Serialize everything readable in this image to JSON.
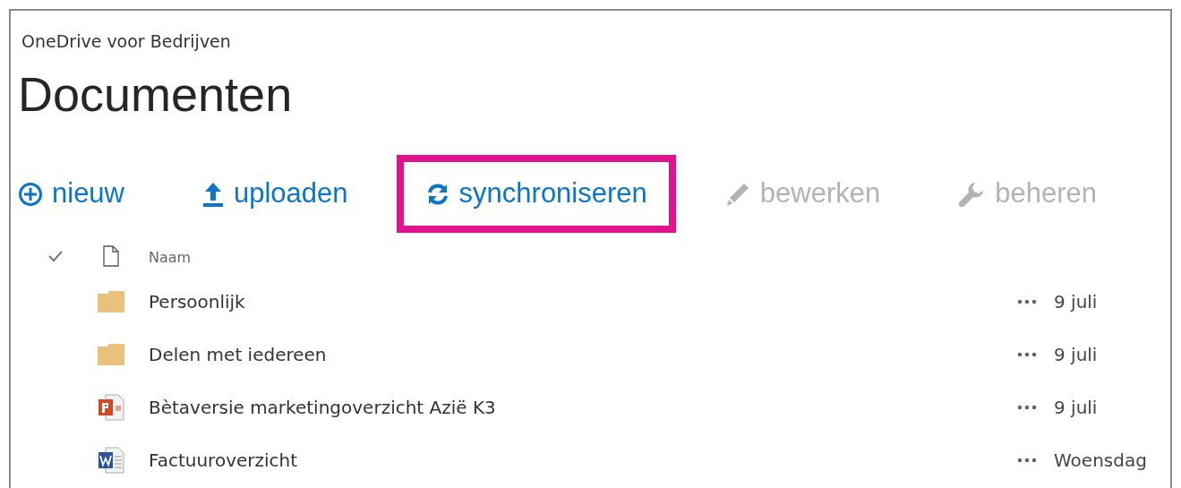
{
  "breadcrumb": "OneDrive voor Bedrijven",
  "title": "Documenten",
  "toolbar": [
    {
      "kind": "add",
      "label": "nieuw",
      "disabled": false,
      "highlighted": false
    },
    {
      "kind": "upload",
      "label": "uploaden",
      "disabled": false,
      "highlighted": false
    },
    {
      "kind": "sync",
      "label": "synchroniseren",
      "disabled": false,
      "highlighted": true
    },
    {
      "kind": "edit",
      "label": "bewerken",
      "disabled": true,
      "highlighted": false
    },
    {
      "kind": "manage",
      "label": "beheren",
      "disabled": true,
      "highlighted": false
    }
  ],
  "table": {
    "columns": [
      {
        "label": "Naam"
      }
    ],
    "rows": [
      {
        "kind": "folder",
        "name": "Persoonlijk",
        "modified": "9 juli"
      },
      {
        "kind": "folder",
        "name": "Delen met iedereen",
        "modified": "9 juli"
      },
      {
        "kind": "powerpoint",
        "name": "Bètaversie marketingoverzicht Azië K3",
        "modified": "9 juli"
      },
      {
        "kind": "word",
        "name": "Factuuroverzicht",
        "modified": "Woensdag"
      }
    ]
  }
}
